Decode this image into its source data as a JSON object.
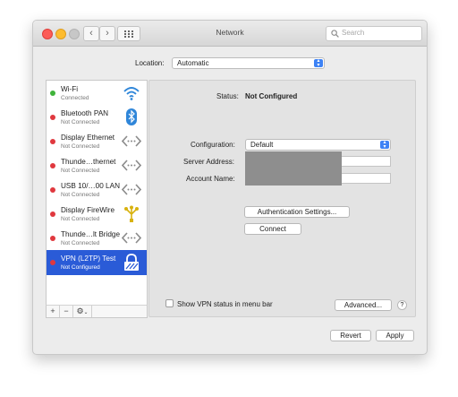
{
  "window": {
    "title": "Network"
  },
  "search": {
    "placeholder": "Search",
    "icon": "magnifier"
  },
  "location": {
    "label": "Location:",
    "value": "Automatic"
  },
  "services": [
    {
      "name": "Wi-Fi",
      "status": "Connected",
      "dot": "#3fb33a",
      "icon": "wifi-icon"
    },
    {
      "name": "Bluetooth PAN",
      "status": "Not Connected",
      "dot": "#e0383e",
      "icon": "bluetooth-icon"
    },
    {
      "name": "Display Ethernet",
      "status": "Not Connected",
      "dot": "#e0383e",
      "icon": "ethernet-icon"
    },
    {
      "name": "Thunde…thernet",
      "status": "Not Connected",
      "dot": "#e0383e",
      "icon": "ethernet-icon"
    },
    {
      "name": "USB 10/…00 LAN",
      "status": "Not Connected",
      "dot": "#e0383e",
      "icon": "ethernet-icon"
    },
    {
      "name": "Display FireWire",
      "status": "Not Connected",
      "dot": "#e0383e",
      "icon": "firewire-icon"
    },
    {
      "name": "Thunde…lt Bridge",
      "status": "Not Connected",
      "dot": "#e0383e",
      "icon": "ethernet-icon"
    },
    {
      "name": "VPN (L2TP) Test",
      "status": "Not Configured",
      "dot": "#e0383e",
      "icon": "vpn-lock-icon",
      "selected": true
    }
  ],
  "sidebar_footer": {
    "add": "+",
    "remove": "−",
    "action": "⚙"
  },
  "detail": {
    "status_label": "Status:",
    "status_value": "Not Configured",
    "configuration_label": "Configuration:",
    "configuration_value": "Default",
    "server_label": "Server Address:",
    "server_value": "",
    "account_label": "Account Name:",
    "account_value": "",
    "auth_button": "Authentication Settings...",
    "connect_button": "Connect",
    "show_vpn_label": "Show VPN status in menu bar",
    "show_vpn_checked": false,
    "advanced_button": "Advanced...",
    "help_button": "?"
  },
  "footer": {
    "revert_button": "Revert",
    "apply_button": "Apply"
  },
  "colors": {
    "selection": "#2a5bd7",
    "accent": "#3d82f5",
    "connected": "#3fb33a",
    "disconnected": "#e0383e"
  }
}
